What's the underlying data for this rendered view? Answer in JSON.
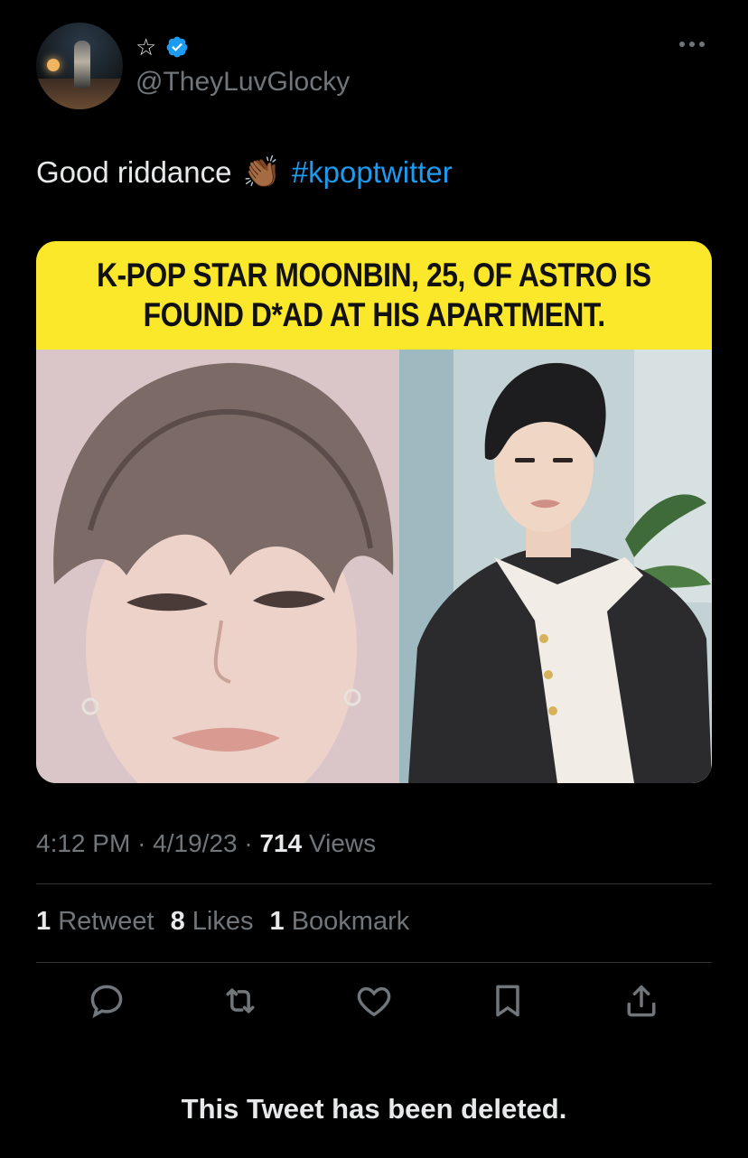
{
  "author": {
    "display_name": "☆",
    "handle": "@TheyLuvGlocky",
    "verified": true,
    "avatar_icon": "avatar-photo"
  },
  "tweet": {
    "text": "Good riddance",
    "emoji": "👏🏾",
    "hashtag": "#kpoptwitter"
  },
  "media": {
    "banner_line1": "K-POP STAR MOONBIN, 25, OF ASTRO IS",
    "banner_line2": "FOUND D*AD AT HIS APARTMENT.",
    "banner_color": "#fbe82a"
  },
  "meta": {
    "time": "4:12 PM",
    "date": "4/19/23",
    "views_count": "714",
    "views_label": "Views"
  },
  "stats": {
    "retweets_count": "1",
    "retweets_label": "Retweet",
    "likes_count": "8",
    "likes_label": "Likes",
    "bookmarks_count": "1",
    "bookmarks_label": "Bookmark"
  },
  "actions": [
    "reply-icon",
    "retweet-icon",
    "like-icon",
    "bookmark-icon",
    "share-icon"
  ],
  "notice": "This Tweet has been deleted.",
  "colors": {
    "background": "#000000",
    "text": "#e7e9ea",
    "muted": "#71767b",
    "accent": "#1d9bf0"
  }
}
